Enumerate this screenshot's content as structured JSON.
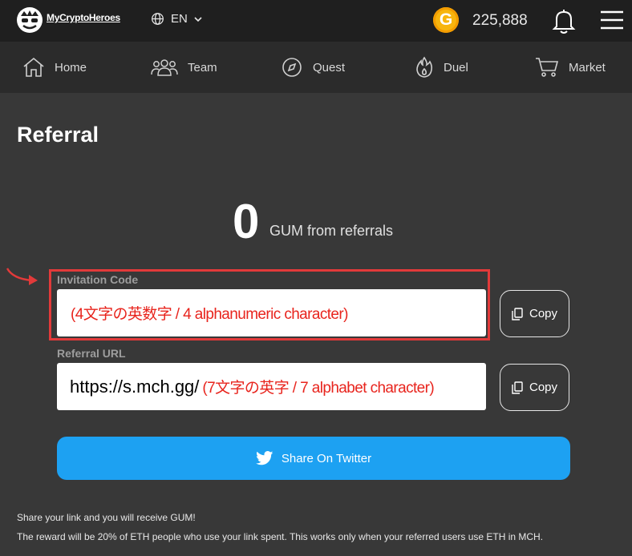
{
  "header": {
    "logo_text": "MyCryptoHeroes",
    "language": "EN",
    "gum_coin_letter": "G",
    "gum_balance": "225,888"
  },
  "nav": {
    "items": [
      {
        "label": "Home",
        "icon": "home-icon"
      },
      {
        "label": "Team",
        "icon": "team-icon"
      },
      {
        "label": "Quest",
        "icon": "compass-icon"
      },
      {
        "label": "Duel",
        "icon": "flame-icon"
      },
      {
        "label": "Market",
        "icon": "cart-icon"
      }
    ]
  },
  "referral": {
    "title": "Referral",
    "gum_count": "0",
    "gum_label": "GUM from referrals",
    "invitation_label": "Invitation Code",
    "invitation_value": "(4文字の英数字 / 4 alphanumeric character)",
    "url_label": "Referral URL",
    "url_prefix": "https://s.mch.gg/",
    "url_value": "(7文字の英字 / 7 alphabet character)",
    "copy_label": "Copy",
    "twitter_label": "Share On Twitter",
    "note_1": "Share your link and you will receive GUM!",
    "note_2": "The reward will be 20% of ETH people who use your link spent. This works only when your referred users use ETH in MCH."
  },
  "colors": {
    "background": "#383838",
    "topbar": "#1f1f1f",
    "navbar": "#2b2b2b",
    "twitter": "#1da1f2",
    "annotation_red": "#e23a3a",
    "gum_gold": "#f7b50e"
  }
}
